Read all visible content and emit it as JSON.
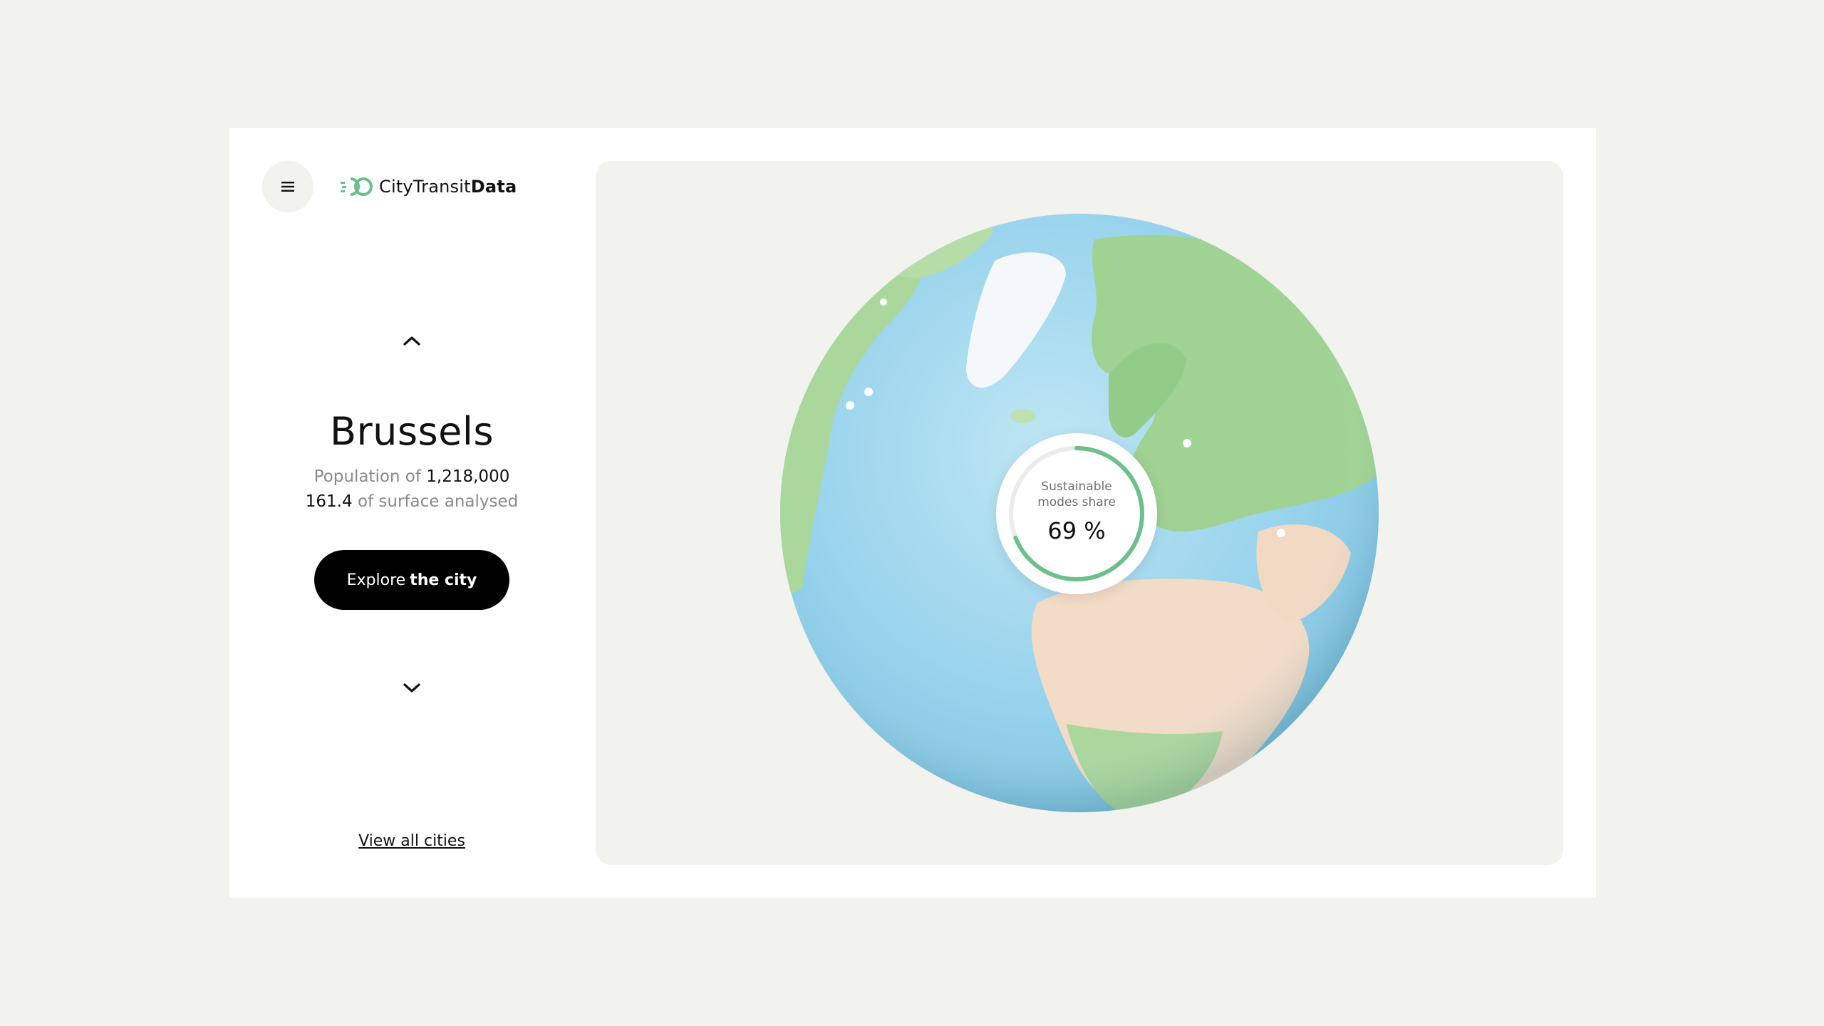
{
  "brand": {
    "name_regular": "CityTransit",
    "name_bold": "Data",
    "accent_color": "#6cc08b"
  },
  "menu": {
    "icon": "hamburger-menu-icon"
  },
  "city": {
    "name": "Brussels",
    "population_label": "Population of",
    "population_value": "1,218,000",
    "surface_value": "161.4",
    "surface_label": "of surface analysed"
  },
  "actions": {
    "explore_regular": "Explore",
    "explore_bold": "the city",
    "view_all": "View all cities",
    "prev_icon": "chevron-up-icon",
    "next_icon": "chevron-down-icon"
  },
  "metric": {
    "label_line1": "Sustainable",
    "label_line2": "modes share",
    "value": "69 %",
    "fraction": 0.69,
    "ring_color": "#6cc08b"
  },
  "colors": {
    "background": "#f2f2ee",
    "card": "#ffffff",
    "ocean": "#9fd6ee",
    "land": "#a6d59a",
    "desert": "#f2dcc8",
    "ice": "#f4f8fa"
  }
}
